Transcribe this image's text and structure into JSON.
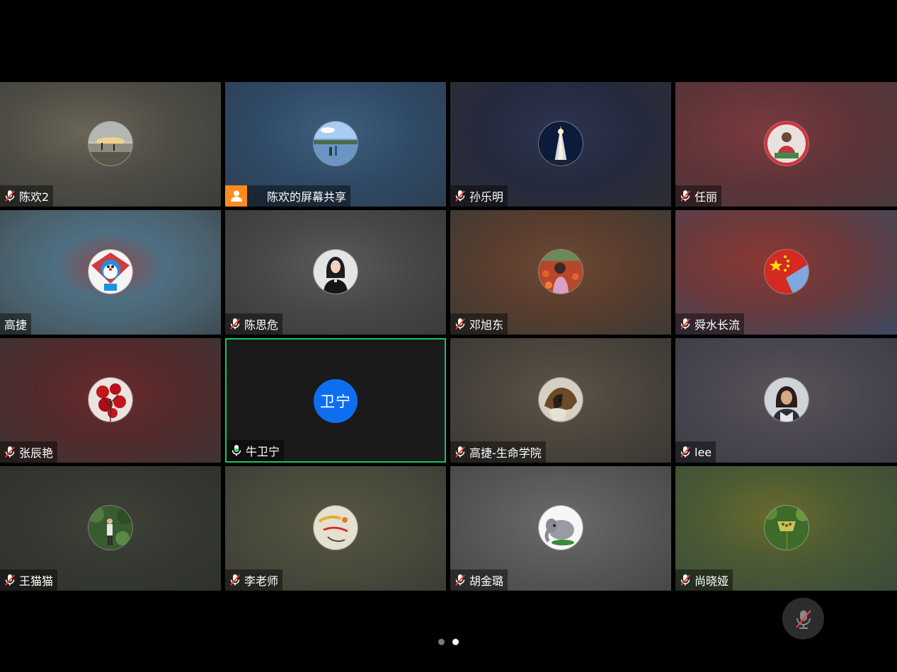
{
  "participants": [
    {
      "name": "陈欢2",
      "mic": "muted",
      "avatar": "sunset-beach-photo"
    },
    {
      "name": "陈欢的屏幕共享",
      "mic": "screen-share",
      "avatar": "lake-photo"
    },
    {
      "name": "孙乐明",
      "mic": "muted",
      "avatar": "tower-night-photo"
    },
    {
      "name": "任丽",
      "mic": "muted",
      "avatar": "person-red-photo"
    },
    {
      "name": "高捷",
      "mic": "none",
      "avatar": "doraemon-kite-photo"
    },
    {
      "name": "陈思危",
      "mic": "muted",
      "avatar": "woman-portrait-photo"
    },
    {
      "name": "邓旭东",
      "mic": "muted",
      "avatar": "tulips-child-photo"
    },
    {
      "name": "舜水长流",
      "mic": "muted",
      "avatar": "china-flag-photo"
    },
    {
      "name": "张辰艳",
      "mic": "muted",
      "avatar": "red-flowers-photo"
    },
    {
      "name": "牛卫宁",
      "mic": "active",
      "avatar": "text",
      "avatar_text": "卫宁"
    },
    {
      "name": "高捷-生命学院",
      "mic": "muted",
      "avatar": "dog-photo"
    },
    {
      "name": "lee",
      "mic": "muted",
      "avatar": "woman-smiling-photo"
    },
    {
      "name": "王猫猫",
      "mic": "muted",
      "avatar": "forest-person-photo"
    },
    {
      "name": "李老师",
      "mic": "muted",
      "avatar": "drawing-photo"
    },
    {
      "name": "胡金璐",
      "mic": "muted",
      "avatar": "elephant-toy-photo"
    },
    {
      "name": "尚晓娅",
      "mic": "muted",
      "avatar": "lotus-photo"
    }
  ],
  "pagination": {
    "pages": 2,
    "current": 2
  },
  "controls": {
    "mute_icon": "mic-muted-icon"
  },
  "colors": {
    "active_border": "#16c464",
    "share_badge": "#ff8a1e",
    "text_avatar": "#0e6ef0"
  }
}
